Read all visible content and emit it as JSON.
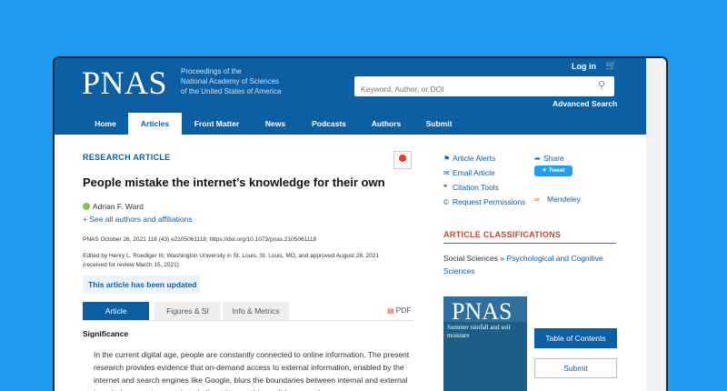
{
  "header": {
    "logo": "PNAS",
    "logo_subtitle_1": "Proceedings of the",
    "logo_subtitle_2": "National Academy of Sciences",
    "logo_subtitle_3": "of the United States of America",
    "login": "Log in",
    "cart_icon": "cart-icon",
    "search_placeholder": "Keyword, Author, or DOI",
    "advanced_search": "Advanced Search"
  },
  "nav": {
    "items": [
      {
        "label": "Home"
      },
      {
        "label": "Articles",
        "active": true
      },
      {
        "label": "Front Matter"
      },
      {
        "label": "News"
      },
      {
        "label": "Podcasts"
      },
      {
        "label": "Authors"
      },
      {
        "label": "Submit"
      }
    ]
  },
  "article": {
    "type": "RESEARCH ARTICLE",
    "title": "People mistake the internet’s knowledge for their own",
    "author": "Adrian F. Ward",
    "see_all": "+ See all authors and affiliations",
    "pub_line": "PNAS October 26, 2021 118 (43) e2105061118; https://doi.org/10.1073/pnas.2105061118",
    "edited_1": "Edited by Henry L. Roediger III, Washington University in St. Louis, St. Louis, MO, and approved August 28, 2021",
    "edited_2": "(received for review March 15, 2021)",
    "updated_notice": "This article has been updated"
  },
  "tabs": [
    {
      "label": "Article",
      "active": true
    },
    {
      "label": "Figures & SI"
    },
    {
      "label": "Info & Metrics"
    }
  ],
  "pdf_label": "PDF",
  "significance": {
    "heading": "Significance",
    "text": "In the current digital age, people are constantly connected to online information. The present research provides evidence that on-demand access to external information, enabled by the internet and search engines like Google, blurs the boundaries between internal and external knowledge, causing people to believe they could—or did—remember"
  },
  "sidebar": {
    "alerts": "Article Alerts",
    "email": "Email Article",
    "citation": "Citation Tools",
    "permissions": "Request Permissions",
    "share": "Share",
    "tweet": "Tweet",
    "mendeley": "Mendeley",
    "classifications_heading": "ARTICLE CLASSIFICATIONS",
    "class_prefix": "Social Sciences » ",
    "class_link": "Psychological and Cognitive Sciences",
    "cover_title": "PNAS",
    "cover_text": "Summer rainfall and soil moisture",
    "toc": "Table of Contents",
    "submit": "Submit"
  },
  "colors": {
    "brand": "#0d5fa3",
    "background": "#1e9bf0",
    "accent": "#c9432f"
  }
}
